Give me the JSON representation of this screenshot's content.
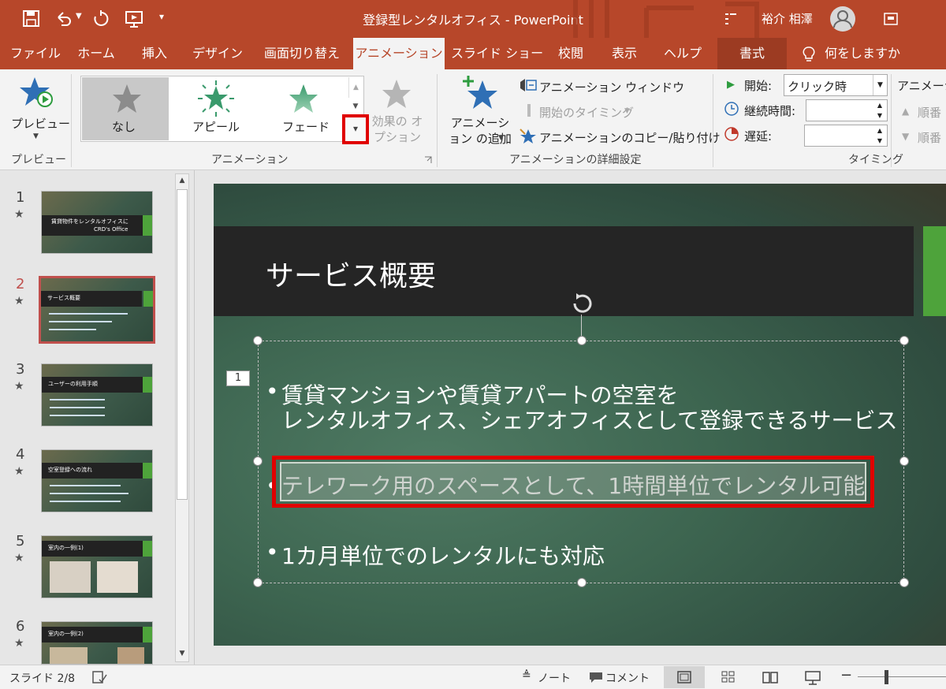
{
  "app": {
    "title": "登録型レンタルオフィス - PowerPoint",
    "user": "裕介 相澤"
  },
  "tabs": [
    "ファイル",
    "ホーム",
    "挿入",
    "デザイン",
    "画面切り替え",
    "アニメーション",
    "スライド ショー",
    "校閲",
    "表示",
    "ヘルプ",
    "書式",
    "何をしますか"
  ],
  "ribbon": {
    "preview": {
      "label": "プレビュー",
      "group": "プレビュー"
    },
    "animation_gallery": {
      "items": [
        "なし",
        "アピール",
        "フェード"
      ],
      "effect_options": "効果の オプション",
      "group": "アニメーション"
    },
    "advanced": {
      "add_animation": "アニメーション の追加",
      "animation_window": "アニメーション ウィンドウ",
      "trigger": "開始のタイミング",
      "painter": "アニメーションのコピー/貼り付け",
      "group": "アニメーションの詳細設定"
    },
    "timing": {
      "start_label": "開始:",
      "start_value": "クリック時",
      "duration_label": "継続時間:",
      "delay_label": "遅延:",
      "reorder_title": "アニメーシ",
      "move_earlier": "順番",
      "move_later": "順番",
      "group": "タイミング"
    }
  },
  "slides": [
    {
      "num": "1",
      "title": "賃貸物件をレンタルオフィスに",
      "sub": "CRD's Office"
    },
    {
      "num": "2",
      "title": "サービス概要"
    },
    {
      "num": "3",
      "title": "ユーザーの利用手順"
    },
    {
      "num": "4",
      "title": "空室登録への流れ"
    },
    {
      "num": "5",
      "title": "室内の一例(1)"
    },
    {
      "num": "6",
      "title": "室内の一例(2)"
    }
  ],
  "slide": {
    "title": "サービス概要",
    "anim_tag": "1",
    "bullets": [
      "賃貸マンションや賃貸アパートの空室を",
      "レンタルオフィス、シェアオフィスとして登録できるサービス",
      "テレワーク用のスペースとして、1時間単位でレンタル可能",
      "1カ月単位でのレンタルにも対応"
    ]
  },
  "status": {
    "slide_pos": "スライド 2/8",
    "notes": "ノート",
    "comments": "コメント"
  }
}
